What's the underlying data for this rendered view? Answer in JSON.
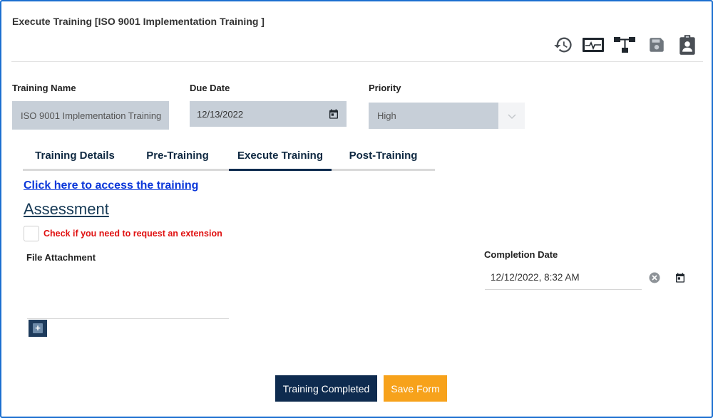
{
  "window": {
    "title": "Execute Training [ISO 9001 Implementation Training ]"
  },
  "toolbar": {
    "icons": [
      "history-icon",
      "monitor-icon",
      "workflow-icon",
      "save-icon",
      "clipboard-user-icon"
    ]
  },
  "fields": {
    "training_name": {
      "label": "Training Name",
      "value": "ISO 9001 Implementation Training"
    },
    "due_date": {
      "label": "Due Date",
      "value": "12/13/2022"
    },
    "priority": {
      "label": "Priority",
      "value": "High"
    }
  },
  "tabs": [
    {
      "label": "Training Details",
      "active": false
    },
    {
      "label": "Pre-Training",
      "active": false
    },
    {
      "label": "Execute Training",
      "active": true
    },
    {
      "label": "Post-Training",
      "active": false
    }
  ],
  "content": {
    "access_link": "Click here to access the training",
    "assessment_heading": "Assessment",
    "extension_checkbox_label": "Check if you need to request an extension",
    "extension_checked": false,
    "file_attachment_label": "File Attachment",
    "add_button_glyph": "+",
    "completion_date": {
      "label": "Completion Date",
      "value": "12/12/2022, 8:32 AM"
    }
  },
  "actions": {
    "training_completed_label": "Training Completed",
    "save_form_label": "Save Form"
  },
  "colors": {
    "accent_navy": "#0e2b4f",
    "save_orange": "#f7a21b",
    "link_blue": "#0b37d9",
    "warning_red": "#e01010",
    "frame_blue": "#1b6fd0"
  }
}
